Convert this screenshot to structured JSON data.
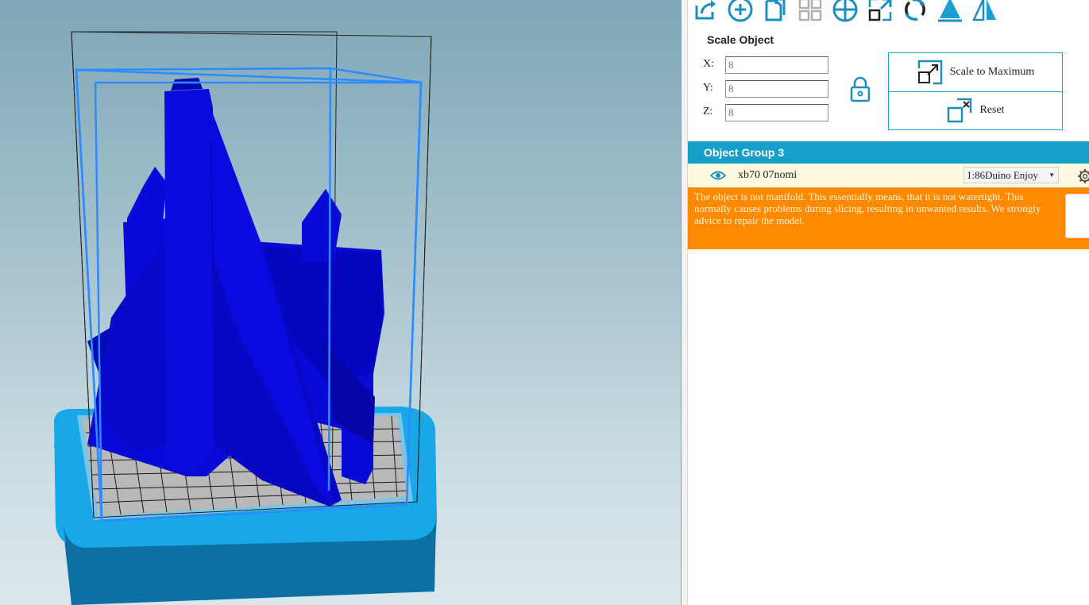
{
  "scale": {
    "title": "Scale Object",
    "x_label": "X:",
    "y_label": "Y:",
    "z_label": "Z:",
    "x_value": "8",
    "y_value": "8",
    "z_value": "8",
    "scale_max_label": "Scale to Maximum",
    "reset_label": "Reset"
  },
  "toolbar": {
    "icons": [
      "export-icon",
      "add-object-icon",
      "copy-icon",
      "grid-arrange-icon",
      "center-icon",
      "scale-icon",
      "rotate-icon",
      "land-icon",
      "mirror-icon"
    ]
  },
  "object_group": {
    "title": "Object Group 3",
    "object_name": "xb70 07nomi",
    "printer": "1:86Duino Enjoy"
  },
  "warning": {
    "text": "The object is not manifold. This essentially means, that it is not watertight. This normally causes problems during slicing, resulting in unwanted results. We strongly advice to repair the model."
  },
  "colors": {
    "accent": "#169fc9",
    "warning": "#ff8a00",
    "model": "#0a0ad8",
    "bed": "#18a8e8"
  }
}
